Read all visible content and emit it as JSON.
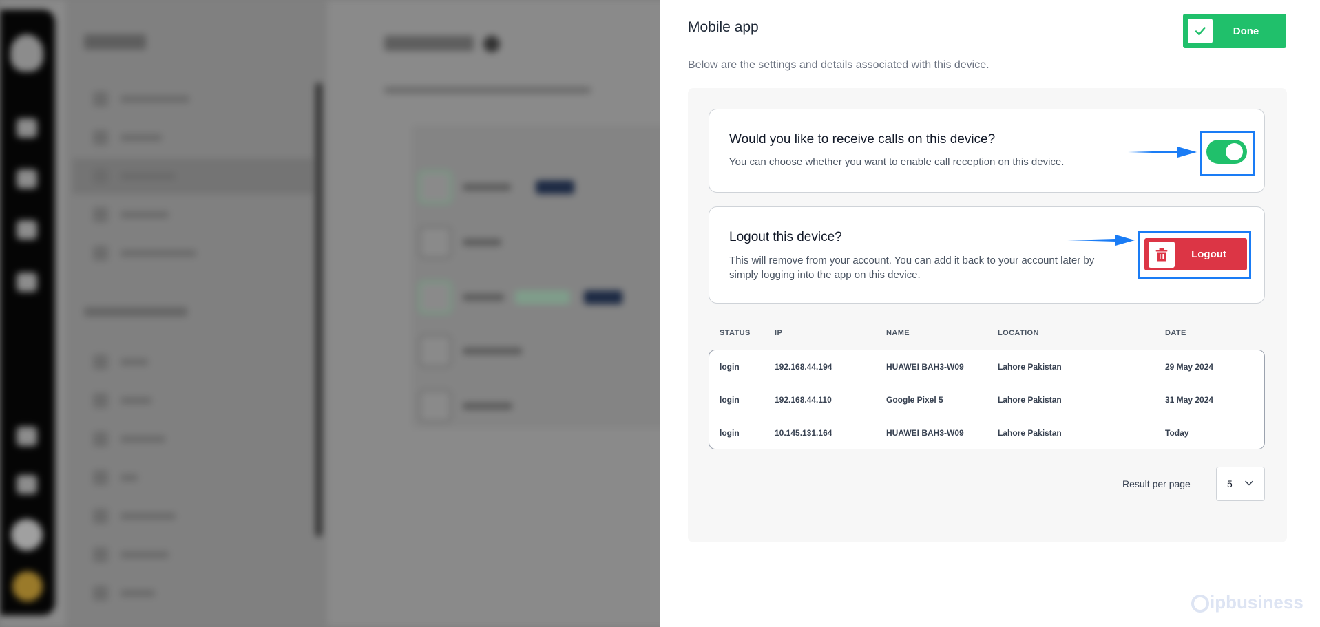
{
  "drawer": {
    "title": "Mobile app",
    "description": "Below are the settings and details associated with this device.",
    "done_label": "Done"
  },
  "receive_calls": {
    "heading": "Would you like to receive calls on this device?",
    "text": "You can choose whether you want to enable call reception on this device.",
    "enabled": true
  },
  "logout": {
    "heading": "Logout this device?",
    "text_line1": "This will remove from your account. You can add it back to your account later by",
    "text_line2": "simply logging into the app on this device.",
    "button_label": "Logout"
  },
  "table": {
    "columns": [
      "STATUS",
      "IP",
      "NAME",
      "LOCATION",
      "DATE"
    ],
    "rows": [
      [
        "login",
        "192.168.44.194",
        "HUAWEI BAH3-W09",
        "Lahore Pakistan",
        "29 May 2024"
      ],
      [
        "login",
        "192.168.44.110",
        "Google Pixel 5",
        "Lahore Pakistan",
        "31 May 2024"
      ],
      [
        "login",
        "10.145.131.164",
        "HUAWEI BAH3-W09",
        "Lahore Pakistan",
        "Today"
      ]
    ]
  },
  "pagination": {
    "label": "Result per page",
    "value": "5"
  },
  "watermark": "ipbusiness",
  "colors": {
    "accent_green": "#20c06b",
    "danger_red": "#dc3545",
    "highlight_blue": "#1a7cf5"
  }
}
